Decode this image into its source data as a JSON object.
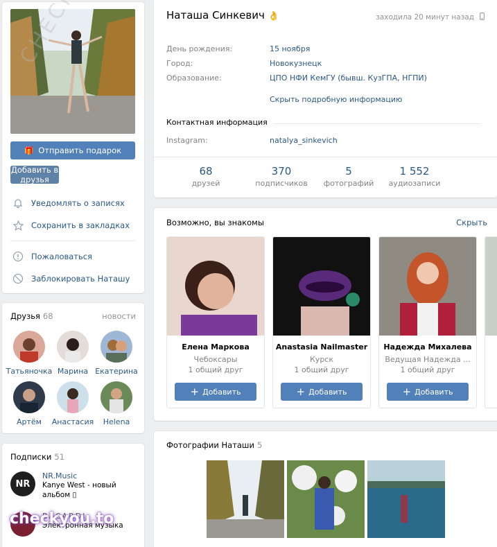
{
  "profile": {
    "name": "Наташа Синкевич",
    "name_emoji": "👌",
    "online_status": "заходила 20 минут назад",
    "info": [
      {
        "label": "День рождения:",
        "value": "15 ноября"
      },
      {
        "label": "Город:",
        "value": "Новокузнецк"
      },
      {
        "label": "Образование:",
        "value": "ЦПО НФИ КемГУ (бывш. КузГПА, НГПИ)"
      }
    ],
    "hide_details": "Скрыть подробную информацию",
    "contacts_title": "Контактная информация",
    "instagram_label": "Instagram:",
    "instagram_value": "natalya_sinkevich",
    "counters": [
      {
        "num": "68",
        "label": "друзей"
      },
      {
        "num": "370",
        "label": "подписчиков"
      },
      {
        "num": "5",
        "label": "фотографий"
      },
      {
        "num": "1 552",
        "label": "аудиозаписи"
      }
    ]
  },
  "actions": {
    "send_gift": "Отправить подарок",
    "add_friend": "Добавить в друзья",
    "notify": "Уведомлять о записях",
    "bookmark": "Сохранить в закладках",
    "report": "Пожаловаться",
    "block": "Заблокировать Наташу"
  },
  "friends": {
    "title": "Друзья",
    "count": "68",
    "news": "новости",
    "items": [
      {
        "name": "Татьяночка"
      },
      {
        "name": "Марина"
      },
      {
        "name": "Екатерина"
      },
      {
        "name": "Артём"
      },
      {
        "name": "Анастасия"
      },
      {
        "name": "Helena"
      }
    ]
  },
  "subscriptions": {
    "title": "Подписки",
    "count": "51",
    "items": [
      {
        "name": "NR.Music",
        "desc": "Kanye West - новый альбом ▯",
        "ava_text": "NR"
      },
      {
        "name": "BACARDI",
        "desc": "Электронная музыка"
      }
    ]
  },
  "people": {
    "title": "Возможно, вы знакомы",
    "hide": "Скрыть",
    "add_label": "Добавить",
    "items": [
      {
        "name": "Елена Маркова",
        "city": "Чебоксары",
        "mutual": "1 общий друг"
      },
      {
        "name": "Anastasia Nailmaster",
        "city": "Курск",
        "mutual": "1 общий друг"
      },
      {
        "name": "Надежда Михалева",
        "city": "Ведущая Надежда ...",
        "mutual": "1 общий друг"
      }
    ]
  },
  "photos": {
    "title": "Фотографии Наташи",
    "count": "5"
  },
  "watermarks": {
    "diagonal": "CHECKYOU.ME",
    "bottom": "checkyou.to"
  },
  "colors": {
    "link": "#2a5885",
    "button": "#5181b8",
    "background": "#edeef0"
  }
}
